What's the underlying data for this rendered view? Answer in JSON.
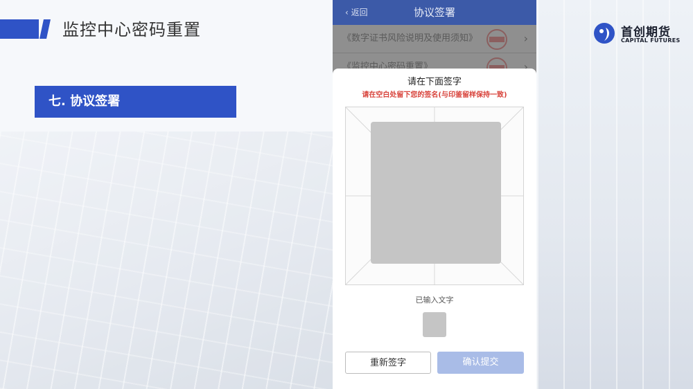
{
  "slide": {
    "title": "监控中心密码重置",
    "section": "七. 协议签署"
  },
  "logo": {
    "cn": "首创期货",
    "en": "CAPITAL FUTURES",
    "icon": "capital-futures-logo-icon"
  },
  "phone": {
    "nav": {
      "back": "返回",
      "title": "协议签署"
    },
    "docs": [
      {
        "label": "《数字证书风险说明及使用须知》"
      },
      {
        "label": "《监控中心密码重置》"
      }
    ],
    "sheet": {
      "title": "请在下面签字",
      "subtitle": "请在空白处留下您的签名(与印鉴留样保持一致)",
      "entered_label": "已输入文字",
      "reset_label": "重新签字",
      "submit_label": "确认提交"
    }
  },
  "colors": {
    "accent": "#2f53c6",
    "nav": "#3c5aa8",
    "warning_text": "#d8433b",
    "submit_disabled": "#a9bce7"
  }
}
